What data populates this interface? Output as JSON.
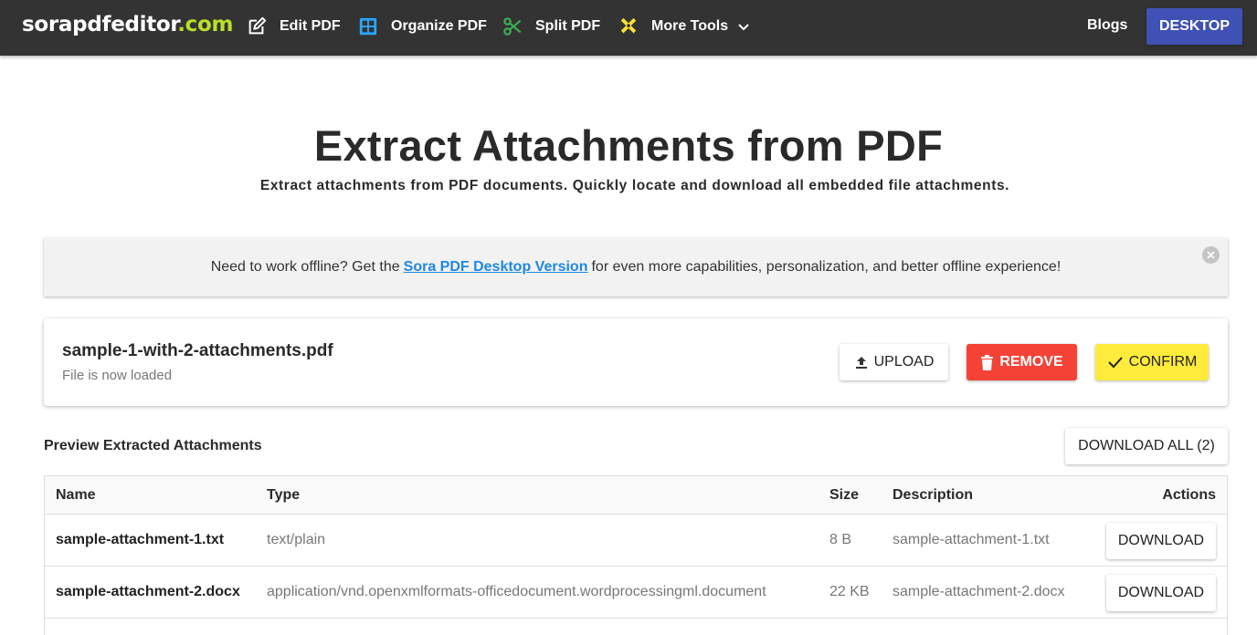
{
  "nav": {
    "logo_main": "sorapdfeditor",
    "logo_tld": ".com",
    "items": [
      {
        "label": "Edit PDF",
        "icon": "edit-icon"
      },
      {
        "label": "Organize PDF",
        "icon": "grid-icon"
      },
      {
        "label": "Split PDF",
        "icon": "scissors-icon"
      },
      {
        "label": "More Tools",
        "icon": "tools-icon"
      }
    ],
    "blogs": "Blogs",
    "desktop": "DESKTOP"
  },
  "hero": {
    "title": "Extract Attachments from PDF",
    "subtitle": "Extract attachments from PDF documents. Quickly locate and download all embedded file attachments."
  },
  "banner": {
    "text_before": "Need to work offline? Get the",
    "link": "Sora PDF Desktop Version",
    "text_after": "for even more capabilities, personalization, and better offline experience!"
  },
  "file": {
    "name": "sample-1-with-2-attachments.pdf",
    "status": "File is now loaded",
    "upload": "UPLOAD",
    "remove": "REMOVE",
    "confirm": "CONFIRM"
  },
  "preview": {
    "title": "Preview Extracted Attachments",
    "download_all": "DOWNLOAD ALL (2)"
  },
  "table": {
    "headers": {
      "name": "Name",
      "type": "Type",
      "size": "Size",
      "description": "Description",
      "actions": "Actions"
    },
    "rows": [
      {
        "name": "sample-attachment-1.txt",
        "type": "text/plain",
        "size": "8 B",
        "description": "sample-attachment-1.txt",
        "action": "DOWNLOAD"
      },
      {
        "name": "sample-attachment-2.docx",
        "type": "application/vnd.openxmlformats-officedocument.wordprocessingml.document",
        "size": "22 KB",
        "description": "sample-attachment-2.docx",
        "action": "DOWNLOAD"
      }
    ]
  },
  "colors": {
    "topbar": "#333333",
    "logo_accent": "#b8e02a",
    "desktop_button": "#3f51b5",
    "remove_button": "#f44336",
    "confirm_button": "#ffeb3b",
    "link": "#1e88e5"
  }
}
